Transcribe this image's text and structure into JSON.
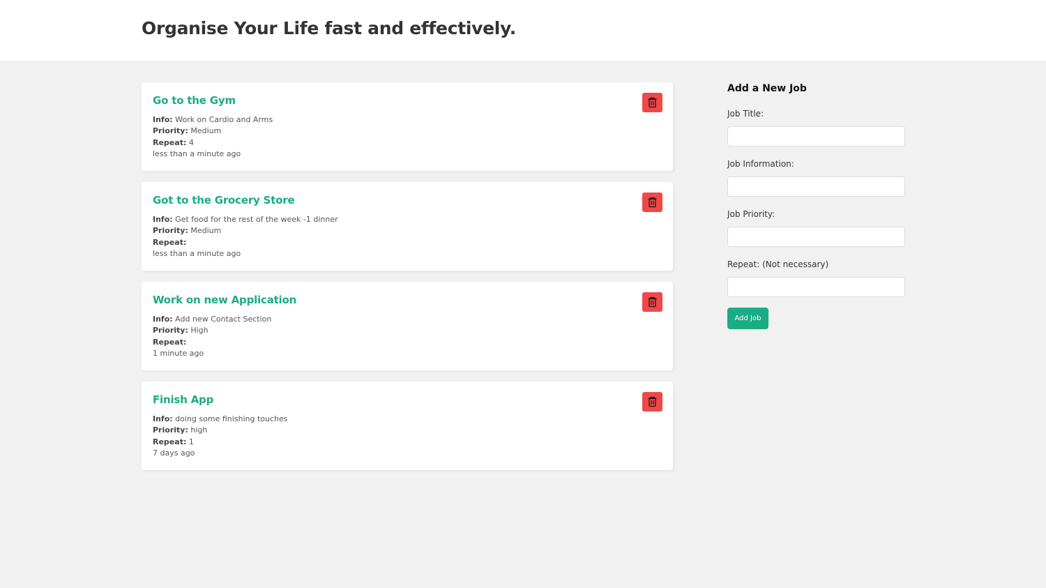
{
  "header": {
    "title": "Organise Your Life fast and effectively."
  },
  "labels": {
    "info": "Info:",
    "priority": "Priority:",
    "repeat": "Repeat:"
  },
  "jobs": [
    {
      "title": "Go to the Gym",
      "info": "Work on Cardio and Arms",
      "priority": "Medium",
      "repeat": "4",
      "time": "less than a minute ago"
    },
    {
      "title": "Got to the Grocery Store",
      "info": "Get food for the rest of the week -1 dinner",
      "priority": "Medium",
      "repeat": "",
      "time": "less than a minute ago"
    },
    {
      "title": "Work on new Application",
      "info": "Add new Contact Section",
      "priority": "High",
      "repeat": "",
      "time": "1 minute ago"
    },
    {
      "title": "Finish App",
      "info": "doing some finishing touches",
      "priority": "high",
      "repeat": "1",
      "time": "7 days ago"
    }
  ],
  "form": {
    "title": "Add a New Job",
    "fields": [
      {
        "label": "Job Title:",
        "value": ""
      },
      {
        "label": "Job Information:",
        "value": ""
      },
      {
        "label": "Job Priority:",
        "value": ""
      },
      {
        "label": "Repeat: (Not necessary)",
        "value": ""
      }
    ],
    "submit_label": "Add Job"
  },
  "icons": {
    "delete": "trash-icon"
  },
  "colors": {
    "accent": "#1aac83",
    "danger": "#f04848",
    "background": "#f1f1f1",
    "card": "#ffffff"
  }
}
